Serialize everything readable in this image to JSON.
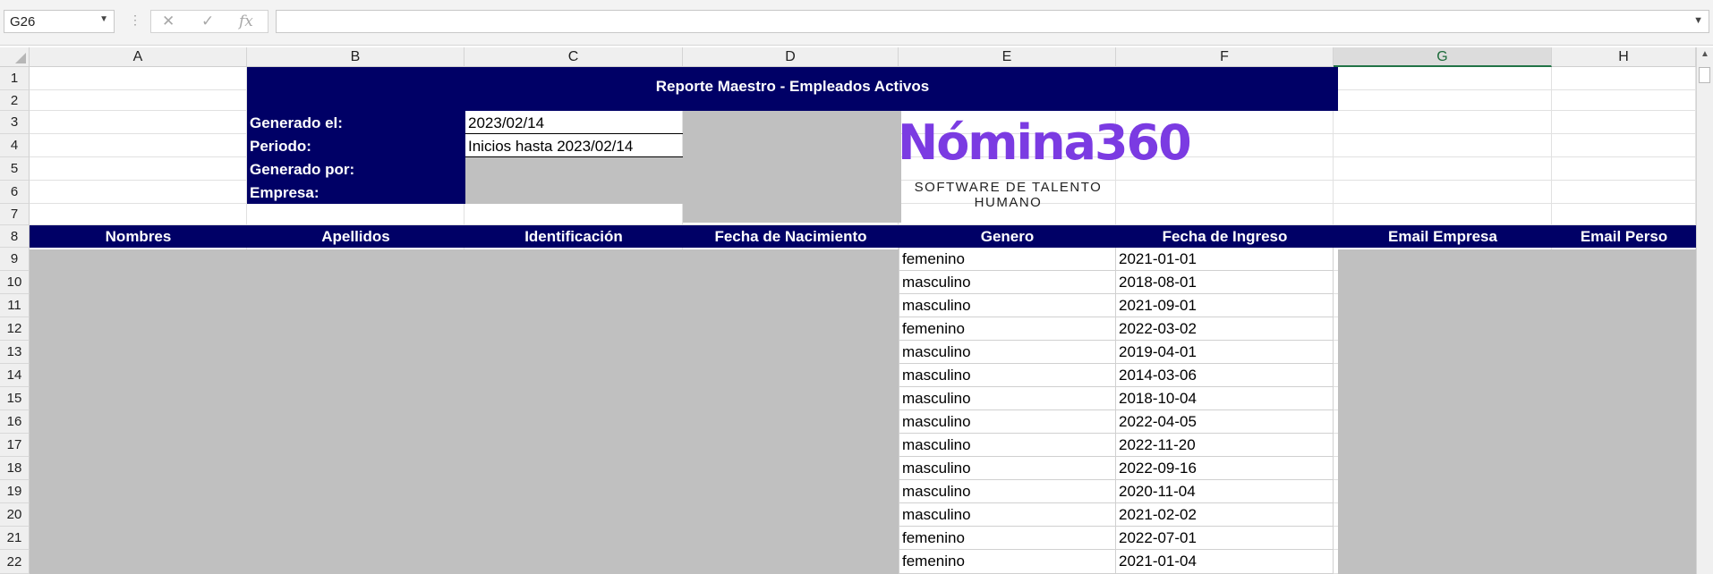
{
  "formula_bar": {
    "name_box": "G26",
    "formula_value": "",
    "cancel_icon": "close-icon",
    "enter_icon": "check-icon",
    "function_icon": "fx-icon"
  },
  "columns": [
    "A",
    "B",
    "C",
    "D",
    "E",
    "F",
    "G",
    "H"
  ],
  "selected_column": "G",
  "rows": [
    "1",
    "2",
    "3",
    "4",
    "5",
    "6",
    "7",
    "8",
    "9",
    "10",
    "11",
    "12",
    "13",
    "14",
    "15",
    "16",
    "17",
    "18",
    "19",
    "20",
    "21",
    "22"
  ],
  "report": {
    "title": "Reporte Maestro - Empleados Activos",
    "generated_on_label": "Generado el:",
    "generated_on_value": "2023/02/14",
    "period_label": "Periodo:",
    "period_value": "Inicios hasta 2023/02/14",
    "generated_by_label": "Generado por:",
    "company_label": "Empresa:"
  },
  "logo": {
    "name": "Nómina360",
    "tagline": "SOFTWARE DE TALENTO HUMANO",
    "color": "#7b3be2"
  },
  "table": {
    "headers": [
      "Nombres",
      "Apellidos",
      "Identificación",
      "Fecha de Nacimiento",
      "Genero",
      "Fecha de Ingreso",
      "Email Empresa",
      "Email Perso"
    ],
    "rows": [
      {
        "genero": "femenino",
        "fecha_ingreso": "2021-01-01"
      },
      {
        "genero": "masculino",
        "fecha_ingreso": "2018-08-01"
      },
      {
        "genero": "masculino",
        "fecha_ingreso": "2021-09-01"
      },
      {
        "genero": "femenino",
        "fecha_ingreso": "2022-03-02"
      },
      {
        "genero": "masculino",
        "fecha_ingreso": "2019-04-01"
      },
      {
        "genero": "masculino",
        "fecha_ingreso": "2014-03-06"
      },
      {
        "genero": "masculino",
        "fecha_ingreso": "2018-10-04"
      },
      {
        "genero": "masculino",
        "fecha_ingreso": "2022-04-05"
      },
      {
        "genero": "masculino",
        "fecha_ingreso": "2022-11-20"
      },
      {
        "genero": "masculino",
        "fecha_ingreso": "2022-09-16"
      },
      {
        "genero": "masculino",
        "fecha_ingreso": "2020-11-04"
      },
      {
        "genero": "masculino",
        "fecha_ingreso": "2021-02-02"
      },
      {
        "genero": "femenino",
        "fecha_ingreso": "2022-07-01"
      },
      {
        "genero": "femenino",
        "fecha_ingreso": "2021-01-04"
      }
    ]
  },
  "colors": {
    "header_navy": "#000066",
    "redaction_gray": "#c0c0c0",
    "selected_column_green": "#217346"
  }
}
